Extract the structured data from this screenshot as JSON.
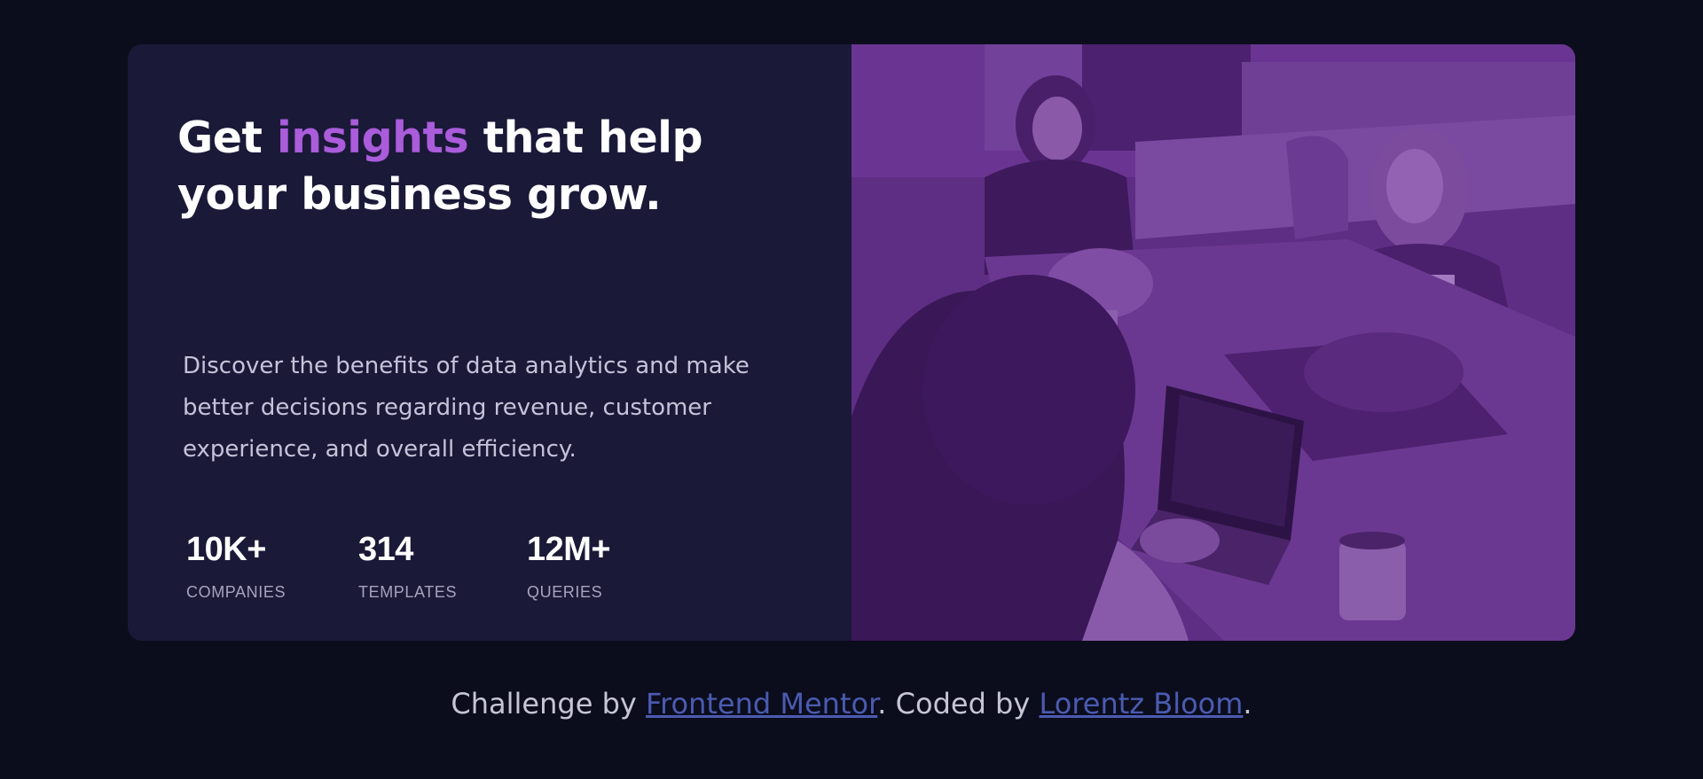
{
  "hero": {
    "headline_prefix": "Get ",
    "headline_accent": "insights",
    "headline_suffix": " that help your business grow.",
    "description": "Discover the benefits of data analytics and make better decisions regarding revenue, customer experience, and overall efficiency."
  },
  "stats": [
    {
      "value": "10K+",
      "label": "COMPANIES"
    },
    {
      "value": "314",
      "label": "TEMPLATES"
    },
    {
      "value": "12M+",
      "label": "QUERIES"
    }
  ],
  "image": {
    "alt": "Team working at a table with laptops",
    "overlay_color": "#6b2c91"
  },
  "footer": {
    "prefix": "Challenge by ",
    "link1": "Frontend Mentor",
    "middle": ". Coded by ",
    "link2": "Lorentz Bloom",
    "suffix": "."
  },
  "colors": {
    "background": "#0b0d1d",
    "card": "#1b1938",
    "accent": "#aa5cdb",
    "link": "#4b5bb1"
  }
}
